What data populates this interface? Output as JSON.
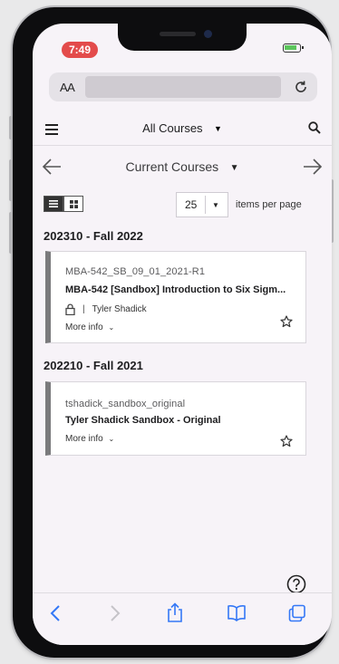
{
  "status": {
    "time": "7:49"
  },
  "browser": {
    "text_size_label": "AA",
    "icons": {
      "reload": "reload-icon",
      "back": "chevron-left-icon",
      "forward": "chevron-right-icon",
      "share": "share-icon",
      "bookmarks": "book-icon",
      "tabs": "tabs-icon"
    }
  },
  "app": {
    "title": "All Courses"
  },
  "term_nav": {
    "label": "Current Courses"
  },
  "controls": {
    "per_page_value": "25",
    "per_page_label": "items per page"
  },
  "sections": [
    {
      "title": "202310 - Fall 2022",
      "course": {
        "code": "MBA-542_SB_09_01_2021-R1",
        "name": "MBA-542 [Sandbox] Introduction to Six Sigm...",
        "instructor": "Tyler Shadick",
        "more_info": "More info"
      }
    },
    {
      "title": "202210 - Fall 2021",
      "course": {
        "code": "tshadick_sandbox_original",
        "name": "Tyler Shadick Sandbox - Original",
        "more_info": "More info"
      }
    }
  ],
  "colors": {
    "accent": "#7a7a7c",
    "time_pill": "#e34b4b",
    "link_blue": "#3478f6"
  }
}
